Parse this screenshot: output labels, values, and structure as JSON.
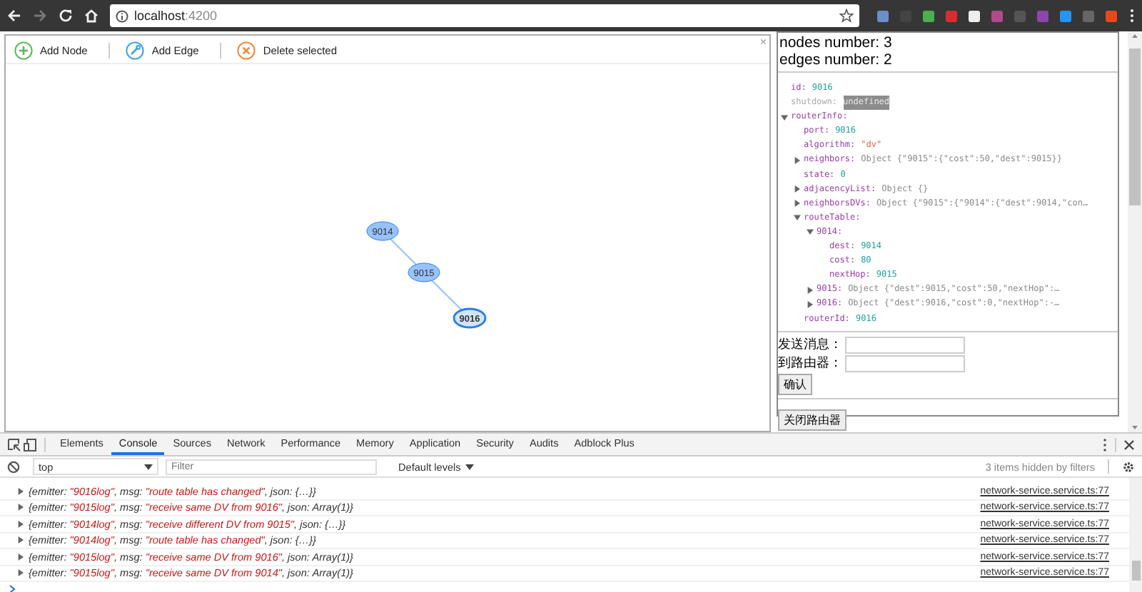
{
  "browser": {
    "host": "localhost",
    "port": ":4200"
  },
  "graph": {
    "toolbar": [
      {
        "kind": "add-node",
        "label": "Add Node"
      },
      {
        "kind": "add-edge",
        "label": "Add Edge"
      },
      {
        "kind": "delete",
        "label": "Delete selected"
      }
    ],
    "close": "×",
    "nodes": [
      {
        "label": "9014",
        "selected": false
      },
      {
        "label": "9015",
        "selected": false
      },
      {
        "label": "9016",
        "selected": true
      }
    ]
  },
  "inspector": {
    "counts": [
      "nodes number: 3",
      "edges number: 2"
    ],
    "tree": [
      {
        "key": "id:",
        "value": "9016",
        "kind": "number"
      },
      {
        "key": "shutdown:",
        "value": "undefined",
        "kind": "undefined"
      },
      {
        "key": "routerInfo:",
        "kind": "object",
        "expanded": true,
        "children": [
          {
            "key": "port:",
            "value": "9016",
            "kind": "number"
          },
          {
            "key": "algorithm:",
            "value": "\"dv\"",
            "kind": "string"
          },
          {
            "key": "neighbors:",
            "value": "Object {\"9015\":{\"cost\":50,\"dest\":9015}}",
            "kind": "object",
            "expanded": false
          },
          {
            "key": "state:",
            "value": "0",
            "kind": "number"
          },
          {
            "key": "adjacencyList:",
            "value": "Object {}",
            "kind": "object",
            "expanded": false
          },
          {
            "key": "neighborsDVs:",
            "value": "Object {\"9015\":{\"9014\":{\"dest\":9014,\"con…",
            "kind": "object",
            "expanded": false
          },
          {
            "key": "routeTable:",
            "kind": "object",
            "expanded": true,
            "children": [
              {
                "key": "9014:",
                "kind": "object",
                "expanded": true,
                "children": [
                  {
                    "key": "dest:",
                    "value": "9014",
                    "kind": "number"
                  },
                  {
                    "key": "cost:",
                    "value": "80",
                    "kind": "number"
                  },
                  {
                    "key": "nextHop:",
                    "value": "9015",
                    "kind": "number"
                  }
                ]
              },
              {
                "key": "9015:",
                "value": "Object {\"dest\":9015,\"cost\":50,\"nextHop\":…",
                "kind": "object",
                "expanded": false
              },
              {
                "key": "9016:",
                "value": "Object {\"dest\":9016,\"cost\":0,\"nextHop\":-…",
                "kind": "object",
                "expanded": false
              }
            ]
          },
          {
            "key": "routerId:",
            "value": "9016",
            "kind": "number"
          }
        ]
      }
    ],
    "form": {
      "fields": [
        {
          "label": "发送消息："
        },
        {
          "label": "到路由器："
        }
      ],
      "confirm": "确认"
    },
    "shutdown_button": "关闭路由器"
  },
  "devtools": {
    "tabs": [
      {
        "label": "Elements",
        "selected": false
      },
      {
        "label": "Console",
        "selected": true
      },
      {
        "label": "Sources",
        "selected": false
      },
      {
        "label": "Network",
        "selected": false
      },
      {
        "label": "Performance",
        "selected": false
      },
      {
        "label": "Memory",
        "selected": false
      },
      {
        "label": "Application",
        "selected": false
      },
      {
        "label": "Security",
        "selected": false
      },
      {
        "label": "Audits",
        "selected": false
      },
      {
        "label": "Adblock Plus",
        "selected": false
      }
    ],
    "context": "top",
    "filter_placeholder": "Filter",
    "levels": "Default levels",
    "hidden_note": "3 items hidden by filters",
    "logs": [
      {
        "message": "{emitter: \"9016log\", msg: \"route table has changed\", json: {…}}",
        "source": "network-service.service.ts:77"
      },
      {
        "message": "{emitter: \"9015log\", msg: \"receive same DV from 9016\", json: Array(1)}",
        "source": "network-service.service.ts:77"
      },
      {
        "message": "{emitter: \"9014log\", msg: \"receive different DV from 9015\", json: {…}}",
        "source": "network-service.service.ts:77"
      },
      {
        "message": "{emitter: \"9014log\", msg: \"route table has changed\", json: {…}}",
        "source": "network-service.service.ts:77"
      },
      {
        "message": "{emitter: \"9015log\", msg: \"receive same DV from 9016\", json: Array(1)}",
        "source": "network-service.service.ts:77"
      },
      {
        "message": "{emitter: \"9015log\", msg: \"receive same DV from 9014\", json: Array(1)}",
        "source": "network-service.service.ts:77"
      }
    ]
  }
}
